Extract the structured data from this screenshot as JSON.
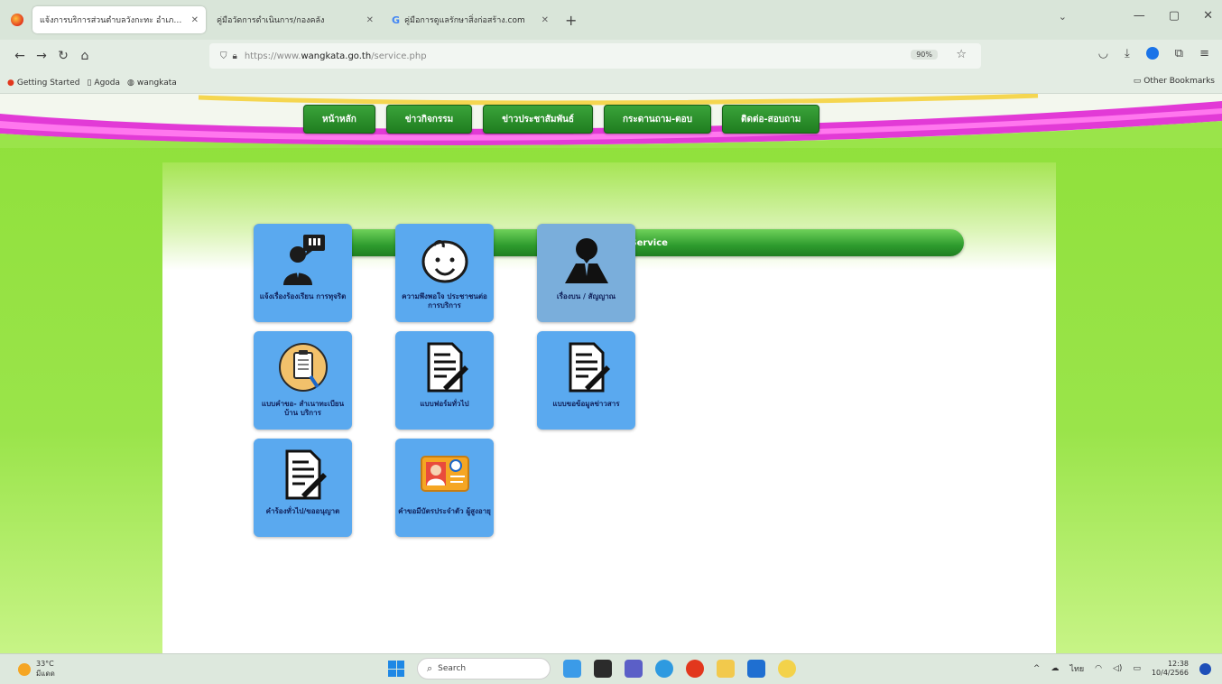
{
  "browser": {
    "tabs": [
      {
        "title": "แจ้งการบริการส่วนตำบลวังกะทะ อำเภอ...",
        "active": true
      },
      {
        "title": "คู่มือวัดการดำเนินการ/กองคลัง",
        "active": false
      },
      {
        "title": "คู่มือการดูแลรักษาสิ่งก่อสร้าง.com",
        "active": false
      }
    ],
    "new_tab": "+",
    "url_prefix": "https://www.",
    "url_host": "wangkata.go.th",
    "url_path": "/service.php",
    "zoom": "90%",
    "bookmarks": [
      "Getting Started",
      "Agoda",
      "wangkata"
    ],
    "other_bookmarks": "Other Bookmarks"
  },
  "site": {
    "menu": [
      "หน้าหลัก",
      "ข่าวกิจกรรม",
      "ข่าวประชาสัมพันธ์",
      "กระดานถาม-ตอบ",
      "ติดต่อ-สอบถาม"
    ],
    "section_title": "บริการประชาชน E-Service",
    "services": [
      {
        "label": "แจ้งเรื่องร้องเรียน การทุจริต",
        "icon": "complaint-person-icon",
        "dim": false
      },
      {
        "label": "ความพึงพอใจ ประชาชนต่อการบริการ",
        "icon": "smiley-face-icon",
        "dim": false
      },
      {
        "label": "เรื่องบน / สัญญาณ",
        "icon": "person-silhouette-icon",
        "dim": true
      },
      {
        "label": "แบบคำขอ- สำเนาทะเบียนบ้าน บริการ",
        "icon": "clipboard-icon",
        "dim": false
      },
      {
        "label": "แบบฟอร์มทั่วไป",
        "icon": "document-pen-icon",
        "dim": false
      },
      {
        "label": "แบบขอข้อมูลข่าวสาร",
        "icon": "document-pen-icon",
        "dim": false
      },
      {
        "label": "คำร้องทั่วไป/ขออนุญาต",
        "icon": "document-pen-icon",
        "dim": false
      },
      {
        "label": "คำขอมีบัตรประจำตัว ผู้สูงอายุ",
        "icon": "id-card-icon",
        "dim": false
      }
    ]
  },
  "taskbar": {
    "weather_temp": "33°C",
    "weather_desc": "มีแดด",
    "search_placeholder": "Search",
    "lang": "ไทย",
    "time": "12:38",
    "date": "10/4/2566"
  },
  "colors": {
    "page_green": "#9ae44a",
    "menu_green": "#2a8f2a",
    "tile_blue": "#5aa9ef",
    "tile_blue_dim": "#7aaedb"
  }
}
